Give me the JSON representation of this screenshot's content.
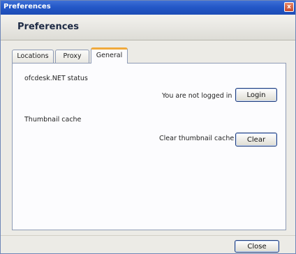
{
  "window": {
    "title": "Preferences",
    "close_glyph": "x"
  },
  "header": {
    "title": "Preferences"
  },
  "tabs": [
    {
      "label": "Locations",
      "active": false
    },
    {
      "label": "Proxy",
      "active": false
    },
    {
      "label": "General",
      "active": true
    }
  ],
  "general": {
    "status_section": "ofcdesk.NET status",
    "login_status": "You are not logged in",
    "login_button": "Login",
    "cache_section": "Thumbnail cache",
    "clear_label": "Clear thumbnail cache",
    "clear_button": "Clear"
  },
  "footer": {
    "close_button": "Close"
  },
  "colors": {
    "titlebar": "#2458c8",
    "active_tab_accent": "#f0a93b",
    "button_border": "#1e3c7b"
  }
}
